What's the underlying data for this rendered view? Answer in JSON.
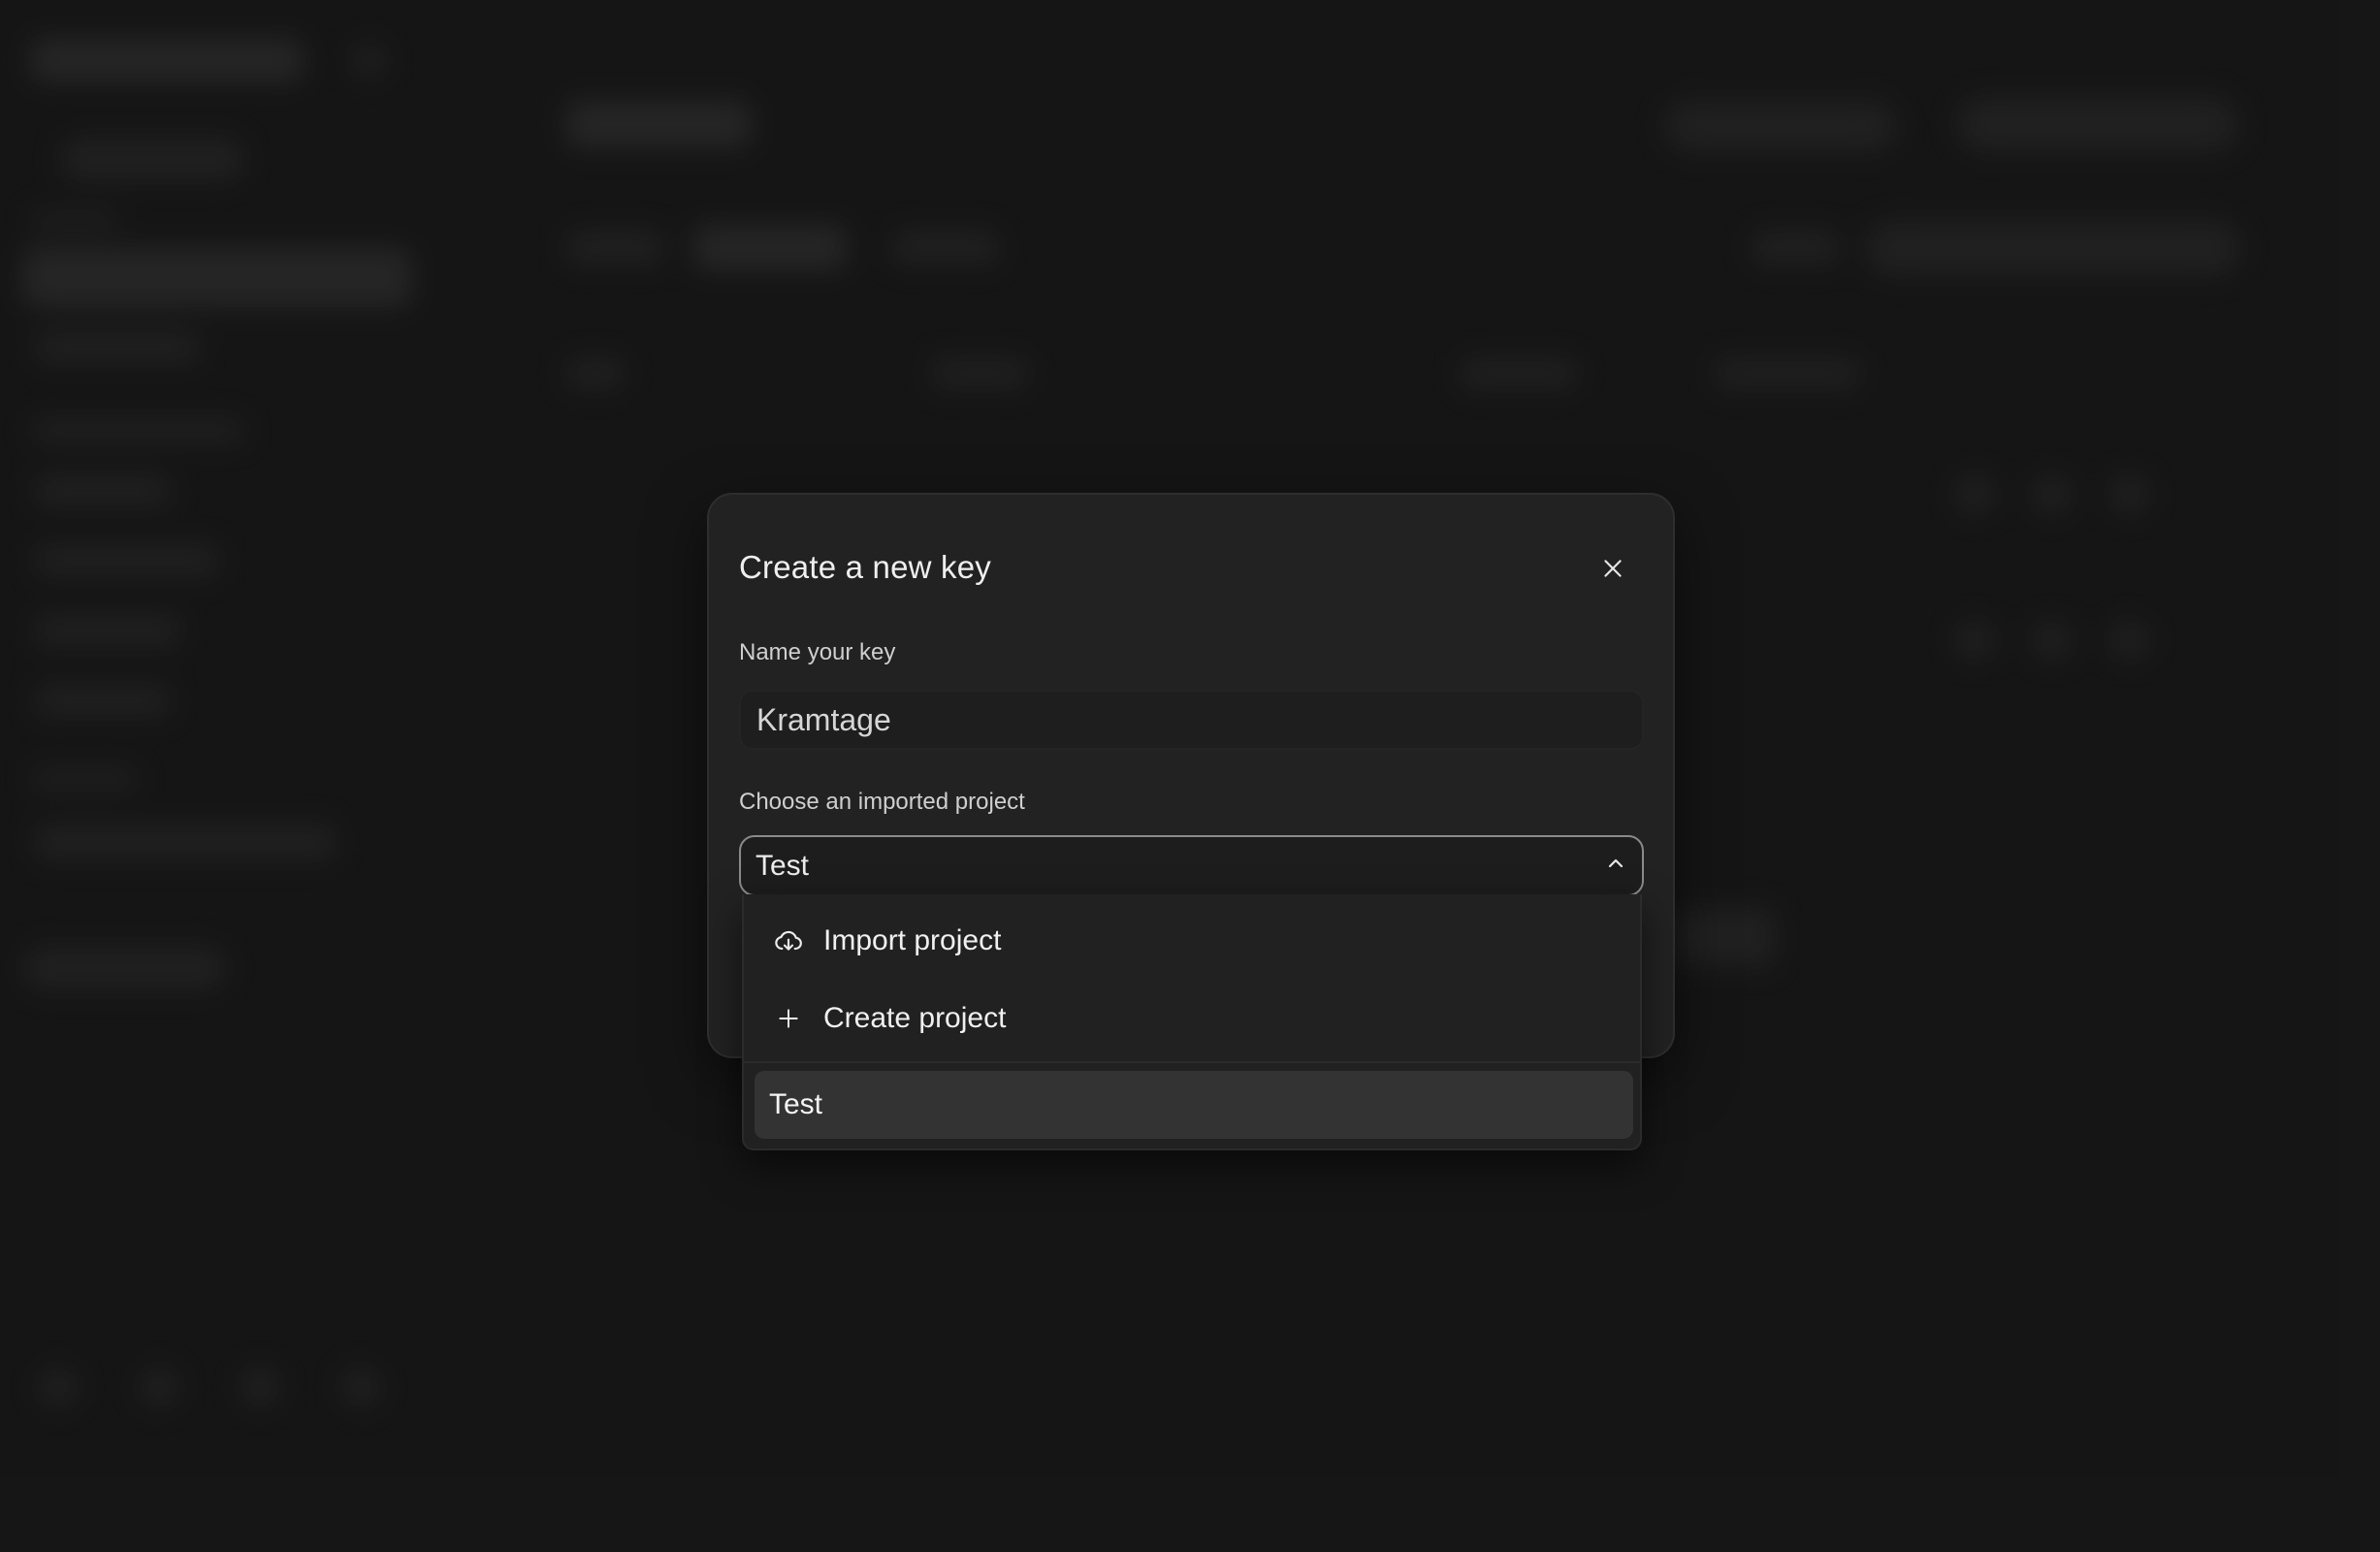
{
  "dialog": {
    "title": "Create a new key",
    "name_label": "Name your key",
    "name_value": "Kramtage",
    "project_label": "Choose an imported project",
    "selected_project": "Test"
  },
  "dropdown": {
    "actions": [
      {
        "label": "Import project",
        "icon": "cloud-download-icon"
      },
      {
        "label": "Create project",
        "icon": "plus-icon"
      }
    ],
    "options": [
      {
        "label": "Test",
        "highlighted": true
      }
    ]
  },
  "colors": {
    "background": "#1b1b1b",
    "dialog": "#222222",
    "highlight": "#333333",
    "text": "#e8e8e8"
  }
}
